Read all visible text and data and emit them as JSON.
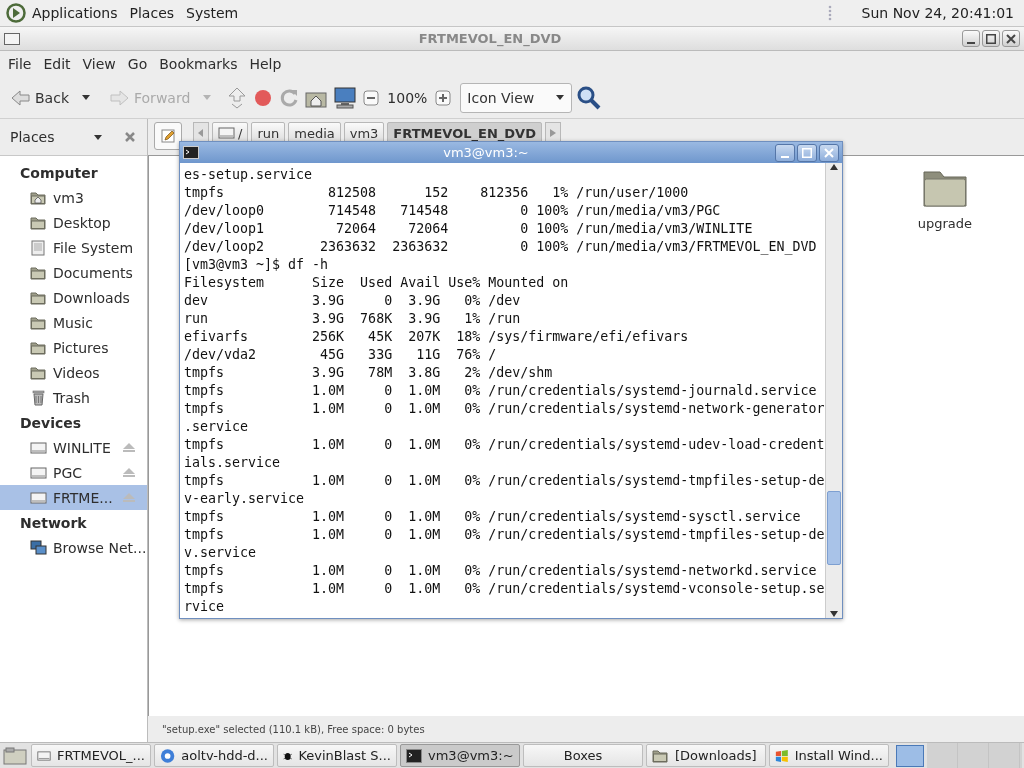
{
  "top_panel": {
    "menus": [
      "Applications",
      "Places",
      "System"
    ],
    "clock": "Sun Nov 24, 20:41:01"
  },
  "file_manager": {
    "title": "FRTMEVOL_EN_DVD",
    "menus": [
      "File",
      "Edit",
      "View",
      "Go",
      "Bookmarks",
      "Help"
    ],
    "toolbar": {
      "back": {
        "label": "Back",
        "disabled": false
      },
      "forward": {
        "label": "Forward",
        "disabled": true
      },
      "zoom": "100%",
      "view": "Icon View"
    },
    "sidebar": {
      "title": "Places",
      "sections": [
        {
          "title": "Computer",
          "items": [
            {
              "label": "vm3",
              "kind": "home",
              "selected": false,
              "eject": false
            },
            {
              "label": "Desktop",
              "kind": "folder",
              "selected": false,
              "eject": false
            },
            {
              "label": "File System",
              "kind": "filesystem",
              "selected": false,
              "eject": false
            },
            {
              "label": "Documents",
              "kind": "folder",
              "selected": false,
              "eject": false
            },
            {
              "label": "Downloads",
              "kind": "folder",
              "selected": false,
              "eject": false
            },
            {
              "label": "Music",
              "kind": "folder",
              "selected": false,
              "eject": false
            },
            {
              "label": "Pictures",
              "kind": "folder",
              "selected": false,
              "eject": false
            },
            {
              "label": "Videos",
              "kind": "folder",
              "selected": false,
              "eject": false
            },
            {
              "label": "Trash",
              "kind": "trash",
              "selected": false,
              "eject": false
            }
          ]
        },
        {
          "title": "Devices",
          "items": [
            {
              "label": "WINLITE",
              "kind": "drive",
              "selected": false,
              "eject": true
            },
            {
              "label": "PGC",
              "kind": "drive",
              "selected": false,
              "eject": true
            },
            {
              "label": "FRTME...",
              "kind": "drive",
              "selected": true,
              "eject": true
            }
          ]
        },
        {
          "title": "Network",
          "items": [
            {
              "label": "Browse Net...",
              "kind": "network",
              "selected": false,
              "eject": false
            }
          ]
        }
      ]
    },
    "breadcrumbs": [
      {
        "label": "/",
        "selected": false
      },
      {
        "label": "run",
        "selected": false
      },
      {
        "label": "media",
        "selected": false
      },
      {
        "label": "vm3",
        "selected": false
      },
      {
        "label": "FRTMEVOL_EN_DVD",
        "selected": true
      }
    ],
    "files": [
      {
        "name": "upgrade"
      }
    ],
    "status": "\"setup.exe\" selected (110.1 kB), Free space: 0 bytes"
  },
  "terminal": {
    "title": "vm3@vm3:~",
    "lines": [
      "es-setup.service",
      "tmpfs             812508      152    812356   1% /run/user/1000",
      "/dev/loop0        714548   714548         0 100% /run/media/vm3/PGC",
      "/dev/loop1         72064    72064         0 100% /run/media/vm3/WINLITE",
      "/dev/loop2       2363632  2363632         0 100% /run/media/vm3/FRTMEVOL_EN_DVD",
      "[vm3@vm3 ~]$ df -h",
      "Filesystem      Size  Used Avail Use% Mounted on",
      "dev             3.9G     0  3.9G   0% /dev",
      "run             3.9G  768K  3.9G   1% /run",
      "efivarfs        256K   45K  207K  18% /sys/firmware/efi/efivars",
      "/dev/vda2        45G   33G   11G  76% /",
      "tmpfs           3.9G   78M  3.8G   2% /dev/shm",
      "tmpfs           1.0M     0  1.0M   0% /run/credentials/systemd-journald.service",
      "tmpfs           1.0M     0  1.0M   0% /run/credentials/systemd-network-generator",
      ".service",
      "tmpfs           1.0M     0  1.0M   0% /run/credentials/systemd-udev-load-credent",
      "ials.service",
      "tmpfs           1.0M     0  1.0M   0% /run/credentials/systemd-tmpfiles-setup-de",
      "v-early.service",
      "tmpfs           1.0M     0  1.0M   0% /run/credentials/systemd-sysctl.service",
      "tmpfs           1.0M     0  1.0M   0% /run/credentials/systemd-tmpfiles-setup-de",
      "v.service",
      "tmpfs           1.0M     0  1.0M   0% /run/credentials/systemd-networkd.service",
      "tmpfs           1.0M     0  1.0M   0% /run/credentials/systemd-vconsole-setup.se",
      "rvice"
    ]
  },
  "taskbar": {
    "items": [
      {
        "label": "FRTMEVOL_...",
        "kind": "drive",
        "selected": false
      },
      {
        "label": "aoltv-hdd-d...",
        "kind": "browser",
        "selected": false
      },
      {
        "label": "KevinBlast S...",
        "kind": "bug",
        "selected": false
      },
      {
        "label": "vm3@vm3:~",
        "kind": "terminal",
        "selected": true
      },
      {
        "label": "Boxes",
        "kind": "plain",
        "selected": false
      },
      {
        "label": "[Downloads]",
        "kind": "folder",
        "selected": false
      },
      {
        "label": "Install Wind...",
        "kind": "windows",
        "selected": false
      }
    ]
  }
}
